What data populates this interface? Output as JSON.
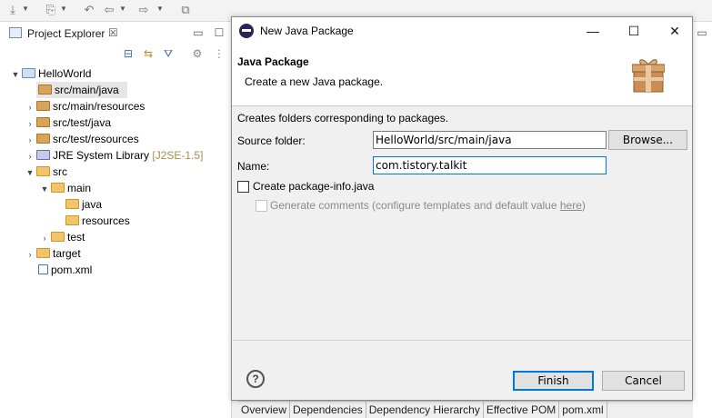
{
  "project_explorer": {
    "title": "Project Explorer",
    "close": "☒",
    "items": [
      {
        "label": "HelloWorld",
        "decor": ""
      },
      {
        "label": "src/main/java",
        "decor": ""
      },
      {
        "label": "src/main/resources",
        "decor": ""
      },
      {
        "label": "src/test/java",
        "decor": ""
      },
      {
        "label": "src/test/resources",
        "decor": ""
      },
      {
        "label": "JRE System Library",
        "decor": "[J2SE-1.5]"
      },
      {
        "label": "src",
        "decor": ""
      },
      {
        "label": "main",
        "decor": ""
      },
      {
        "label": "java",
        "decor": ""
      },
      {
        "label": "resources",
        "decor": ""
      },
      {
        "label": "test",
        "decor": ""
      },
      {
        "label": "target",
        "decor": ""
      },
      {
        "label": "pom.xml",
        "decor": ""
      }
    ]
  },
  "dialog": {
    "title": "New Java Package",
    "heading": "Java Package",
    "subheading": "Create a new Java package.",
    "description": "Creates folders corresponding to packages.",
    "source_folder_label": "Source folder:",
    "source_folder_value": "HelloWorld/src/main/java",
    "browse_label": "Browse...",
    "name_label": "Name:",
    "name_value": "com.tistory.talkit",
    "create_pkg_info_label": "Create package-info.java",
    "generate_comments_label": "Generate comments (configure templates and default value ",
    "generate_comments_link": "here",
    "generate_comments_suffix": ")",
    "finish_label": "Finish",
    "cancel_label": "Cancel",
    "help_glyph": "?"
  },
  "window_controls": {
    "minimize": "—",
    "maximize": "☐",
    "close": "✕"
  },
  "editor_tabs": [
    "Overview",
    "Dependencies",
    "Dependency Hierarchy",
    "Effective POM",
    "pom.xml"
  ],
  "icons": {
    "toolbar": [
      "import-icon",
      "export-icon",
      "back-icon",
      "forward-icon",
      "new-window-icon"
    ]
  }
}
